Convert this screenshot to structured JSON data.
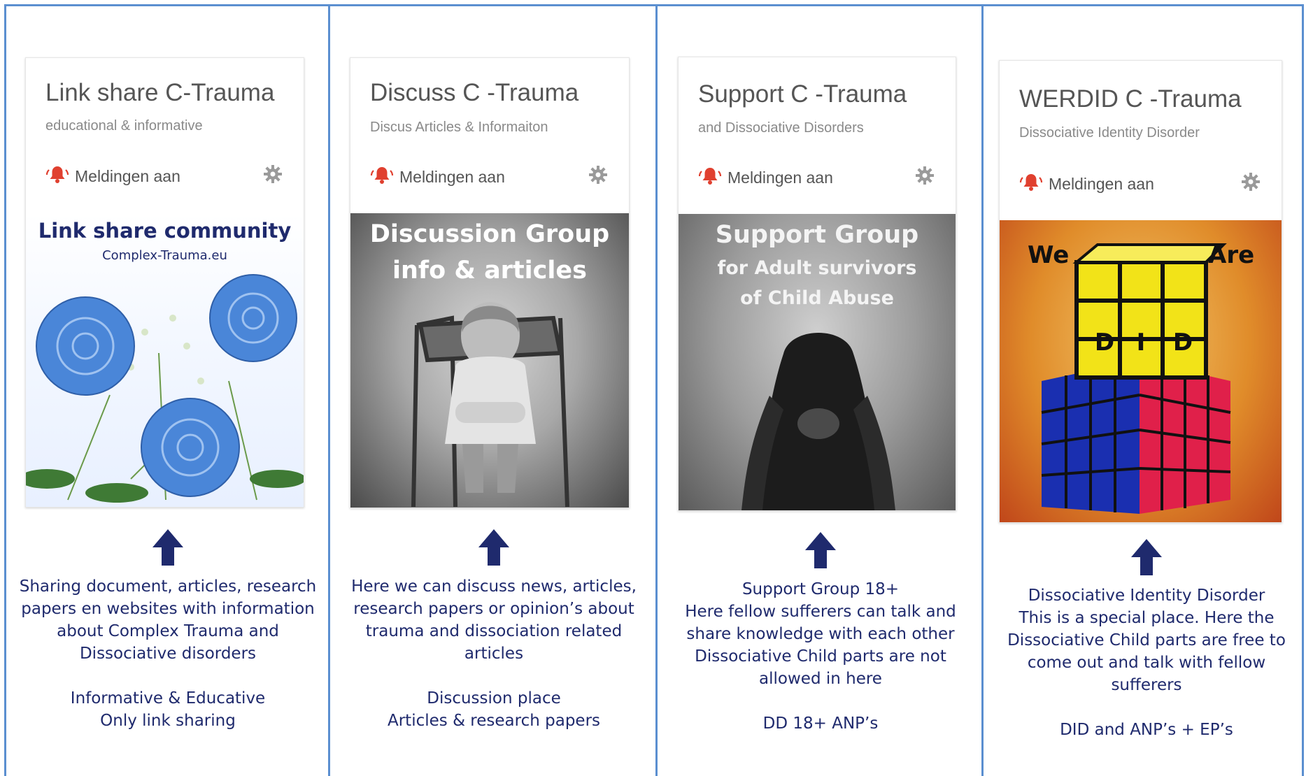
{
  "colors": {
    "frame": "#5b8fd0",
    "text_navy": "#1f2a6d",
    "arrow_navy": "#1f2a6d",
    "notification_red": "#e0402f"
  },
  "notification_label": "Meldingen aan",
  "cards": [
    {
      "title": "Link share C-Trauma",
      "subtitle": "educational & informative",
      "banner": {
        "line1": "Link share community",
        "line2": "Complex-Trauma.eu"
      },
      "description": [
        "Sharing document, articles, research",
        "papers en websites with information",
        "about Complex Trauma and",
        "Dissociative disorders"
      ],
      "notes": [
        "Informative & Educative",
        "Only link sharing"
      ]
    },
    {
      "title": "Discuss C -Trauma",
      "subtitle": "Discus Articles & Informaiton",
      "banner": {
        "line1": "Discussion Group",
        "line2": "info & articles"
      },
      "description": [
        "Here we can discuss news, articles,",
        "research papers or opinion’s about",
        "trauma and dissociation related",
        "articles"
      ],
      "notes": [
        "Discussion place",
        "Articles & research papers"
      ]
    },
    {
      "title": "Support C -Trauma",
      "subtitle": "and Dissociative Disorders",
      "banner": {
        "line1": "Support Group",
        "line2": "for Adult survivors",
        "line3": "of Child Abuse"
      },
      "description": [
        "Support Group 18+",
        "Here fellow sufferers can talk and",
        "share knowledge with each other",
        "Dissociative Child parts are not",
        "allowed in here"
      ],
      "notes": [
        "DD 18+  ANP’s"
      ]
    },
    {
      "title": "WERDID C -Trauma",
      "subtitle": "Dissociative Identity Disorder",
      "banner": {
        "left": "We",
        "right": "Are",
        "letters": [
          "D",
          "I",
          "D"
        ]
      },
      "description": [
        "Dissociative Identity Disorder",
        "This is a special place. Here the",
        "Dissociative Child parts are free to",
        "come out and talk with fellow",
        "sufferers"
      ],
      "notes": [
        "DID and ANP’s +  EP’s"
      ]
    }
  ]
}
